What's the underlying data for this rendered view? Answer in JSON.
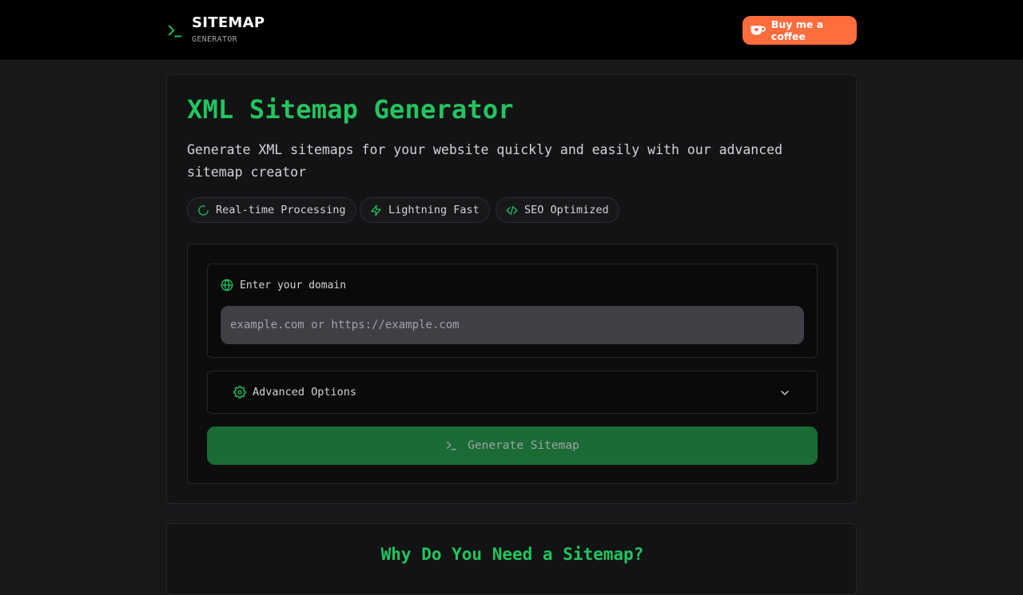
{
  "header": {
    "brand_title": "SITEMAP",
    "brand_subtitle": "GENERATOR",
    "coffee_label": "Buy me a coffee"
  },
  "hero": {
    "title": "XML Sitemap Generator",
    "description": "Generate XML sitemaps for your website quickly and easily with our advanced sitemap creator",
    "chips": [
      {
        "label": "Real-time Processing",
        "icon": "loader-icon"
      },
      {
        "label": "Lightning Fast",
        "icon": "lightning-icon"
      },
      {
        "label": "SEO Optimized",
        "icon": "code-icon"
      }
    ]
  },
  "form": {
    "domain_label": "Enter your domain",
    "domain_placeholder": "example.com or https://example.com",
    "domain_value": "",
    "advanced_label": "Advanced Options",
    "generate_label": "Generate Sitemap"
  },
  "section2": {
    "title": "Why Do You Need a Sitemap?"
  },
  "colors": {
    "accent": "#22c55e",
    "background": "#18181b",
    "header_bg": "#000000",
    "coffee_button": "#ff6d3d",
    "generate_button": "#1a6b36"
  }
}
